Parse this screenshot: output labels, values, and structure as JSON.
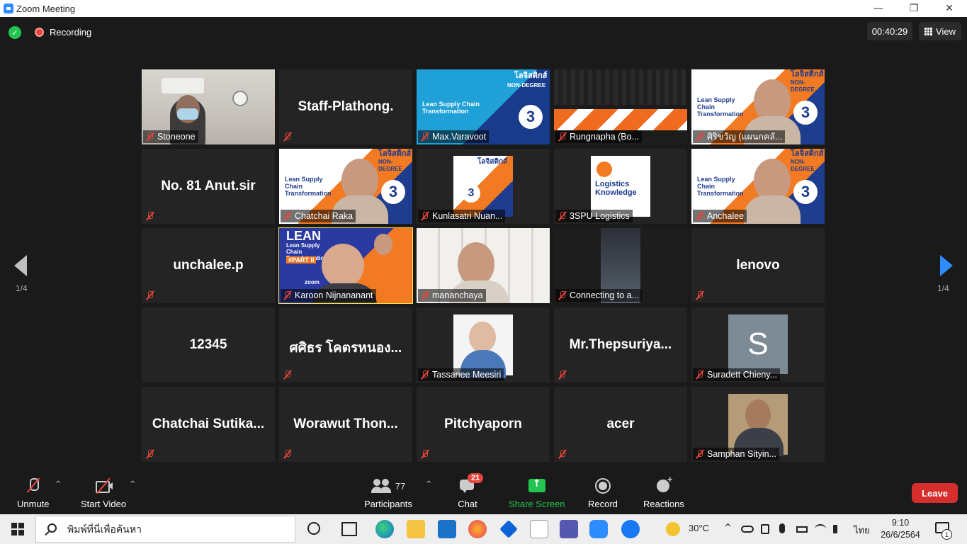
{
  "window": {
    "title": "Zoom Meeting",
    "controls": {
      "minimize": "—",
      "maximize": "❐",
      "close": "✕"
    }
  },
  "topbar": {
    "recording_label": "Recording",
    "timer": "00:40:29",
    "view_label": "View"
  },
  "gallery": {
    "page_left": "1/4",
    "page_right": "1/4",
    "tiles": [
      {
        "name": "Stoneone",
        "big": "",
        "video": "room"
      },
      {
        "name": "",
        "big": "Staff-Plathong.",
        "video": "none"
      },
      {
        "name": "Max.Varavoot",
        "big": "",
        "video": "banner-blue"
      },
      {
        "name": "Rungnapha (Bo...",
        "big": "",
        "video": "stripes"
      },
      {
        "name": "ศิริขวัญ (แผนกคลั...",
        "big": "",
        "video": "banner-person"
      },
      {
        "name": "",
        "big": "No. 81 Anut.sir",
        "video": "none"
      },
      {
        "name": "Chatchai Raka",
        "big": "",
        "video": "banner-person"
      },
      {
        "name": "Kunlasatri Nuan...",
        "big": "",
        "video": "banner-small"
      },
      {
        "name": "3SPU Logistics",
        "big": "",
        "video": "logo"
      },
      {
        "name": "Anchalee",
        "big": "",
        "video": "banner-person"
      },
      {
        "name": "",
        "big": "unchalee.p",
        "video": "none"
      },
      {
        "name": "Karoon Nijnananant",
        "big": "",
        "video": "lean",
        "active": true
      },
      {
        "name": "mananchaya",
        "big": "",
        "video": "shelf"
      },
      {
        "name": "Connecting to a...",
        "big": "",
        "video": "dark"
      },
      {
        "name": "",
        "big": "lenovo",
        "video": "none"
      },
      {
        "name": "",
        "big": "12345",
        "video": "none",
        "nolabel": true
      },
      {
        "name": "",
        "big": "ศศิธร โคตรหนอง...",
        "video": "none"
      },
      {
        "name": "Tassanee Meesiri",
        "big": "",
        "video": "portrait"
      },
      {
        "name": "",
        "big": "Mr.Thepsuriya...",
        "video": "none"
      },
      {
        "name": "Suradett Chieny...",
        "big": "",
        "video": "avatar-s"
      },
      {
        "name": "",
        "big": "Chatchai  Sutika...",
        "video": "none"
      },
      {
        "name": "",
        "big": "Worawut  Thon...",
        "video": "none"
      },
      {
        "name": "",
        "big": "Pitchyaporn",
        "video": "none"
      },
      {
        "name": "",
        "big": "acer",
        "video": "none"
      },
      {
        "name": "Samphan Sityin...",
        "big": "",
        "video": "portrait-man"
      }
    ],
    "banner_text": {
      "lean_title": "Lean Supply Chain Transformation",
      "non_degree": "NON-DEGREE",
      "logistics_title": "โลจิสติกส์",
      "logistics_knowledge": "Logistics Knowledge",
      "lean_big": "LEAN",
      "part": "#PART II",
      "zoom": "zoom",
      "num": "3"
    }
  },
  "toolbar": {
    "unmute": "Unmute",
    "start_video": "Start Video",
    "participants": "Participants",
    "participants_count": "77",
    "chat": "Chat",
    "chat_badge": "21",
    "share": "Share Screen",
    "record": "Record",
    "reactions": "Reactions",
    "leave": "Leave",
    "caret": "^"
  },
  "taskbar": {
    "search_placeholder": "พิมพ์ที่นี่เพื่อค้นหา",
    "weather": "30°C",
    "lang": "ไทย",
    "time": "9:10",
    "date": "26/6/2564",
    "notif_count": "1"
  },
  "colors": {
    "accent": "#2d8cff",
    "leave": "#d62d2d",
    "muted": "#e8453c",
    "share": "#23c552",
    "active_speaker": "#f5e14a"
  }
}
